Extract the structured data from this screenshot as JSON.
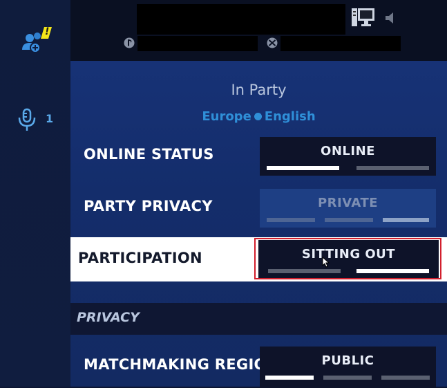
{
  "sidebar": {
    "voice_count": "1",
    "alert_mark": "!"
  },
  "header": {
    "pc_icon": "pc-monitor-icon",
    "speaker_icon": "speaker-icon",
    "playstation_icon": "playstation-icon",
    "xbox_icon": "xbox-icon"
  },
  "party": {
    "title": "In Party",
    "region": "Europe",
    "language": "English"
  },
  "settings": {
    "online_status": {
      "label": "ONLINE STATUS",
      "value": "ONLINE",
      "option_count": 2,
      "selected_index": 0
    },
    "party_privacy": {
      "label": "PARTY PRIVACY",
      "value": "PRIVATE",
      "option_count": 3,
      "selected_index": 2,
      "disabled": true
    },
    "participation": {
      "label": "PARTICIPATION",
      "value": "SITTING OUT",
      "option_count": 2,
      "selected_index": 1,
      "highlighted": true
    }
  },
  "privacy_section": {
    "header": "PRIVACY",
    "matchmaking_region": {
      "label": "MATCHMAKING REGION",
      "value": "PUBLIC",
      "option_count": 3,
      "selected_index": 0
    }
  },
  "colors": {
    "accent_blue": "#2f8fd8",
    "highlight_red": "#d21f2d",
    "alert_yellow": "#f3e619"
  }
}
